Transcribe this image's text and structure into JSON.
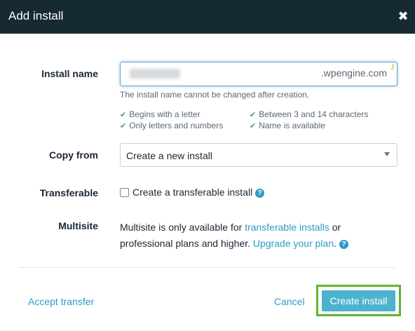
{
  "dialog": {
    "title": "Add install",
    "close_glyph": "✖"
  },
  "form": {
    "install_name": {
      "label": "Install name",
      "suffix": ".wpengine.com",
      "help": "The install name cannot be changed after creation.",
      "rules": [
        "Begins with a letter",
        "Only letters and numbers",
        "Between 3 and 14 characters",
        "Name is available"
      ]
    },
    "copy_from": {
      "label": "Copy from",
      "selected": "Create a new install"
    },
    "transferable": {
      "label": "Transferable",
      "checkbox_label": "Create a transferable install",
      "checked": false
    },
    "multisite": {
      "label": "Multisite",
      "text_1": "Multisite is only available for ",
      "link_1": "transferable installs",
      "text_2": " or professional plans and higher. ",
      "link_2": "Upgrade your plan",
      "text_3": "."
    }
  },
  "footer": {
    "accept_transfer": "Accept transfer",
    "cancel": "Cancel",
    "create": "Create install"
  },
  "colors": {
    "header_bg": "#162a33",
    "link": "#2e9bc4",
    "primary_button": "#4cb3cf",
    "highlight_outline": "#5cb832",
    "check": "#4aa05b"
  },
  "icons": {
    "close": "close-icon",
    "check": "check-icon",
    "help": "question-circle-icon",
    "caret": "chevron-down-icon",
    "key": "key-icon"
  }
}
